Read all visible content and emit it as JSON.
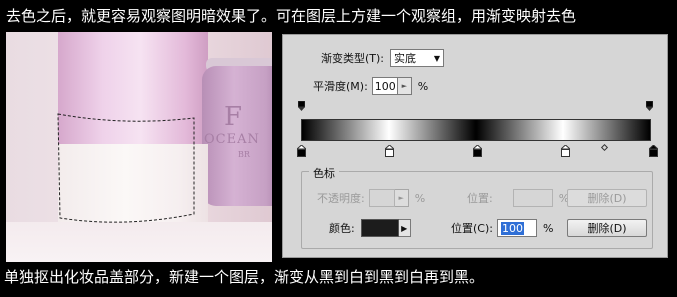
{
  "captions": {
    "top": "去色之后，就更容易观察图明暗效果了。可在图层上方建一个观察组，用渐变映射去色",
    "bottom": "单独抠出化妆品盖部分，新建一个图层，渐变从黑到白到黑到白再到黑。"
  },
  "photo": {
    "brand_big": "F",
    "brand_mid": "OCEAN",
    "brand_small": "BR"
  },
  "gradient_editor": {
    "type_label": "渐变类型(T):",
    "type_value": "实底",
    "smoothness_label": "平滑度(M):",
    "smoothness_value": "100",
    "smoothness_unit": "%",
    "stops": [
      {
        "location": 0,
        "color": "#000000"
      },
      {
        "location": 25,
        "color": "#ffffff"
      },
      {
        "location": 50,
        "color": "#000000"
      },
      {
        "location": 75,
        "color": "#ffffff"
      },
      {
        "location": 100,
        "color": "#000000"
      }
    ],
    "color_stops_group": {
      "title": "色标",
      "opacity_label": "不透明度:",
      "opacity_unit": "%",
      "location_label_disabled": "位置:",
      "location_unit_disabled": "%",
      "delete_disabled": "删除(D)",
      "color_label": "颜色:",
      "color_value": "#1c1c1c",
      "location_label": "位置(C):",
      "location_value": "100",
      "location_unit": "%",
      "delete_label": "删除(D)"
    }
  }
}
